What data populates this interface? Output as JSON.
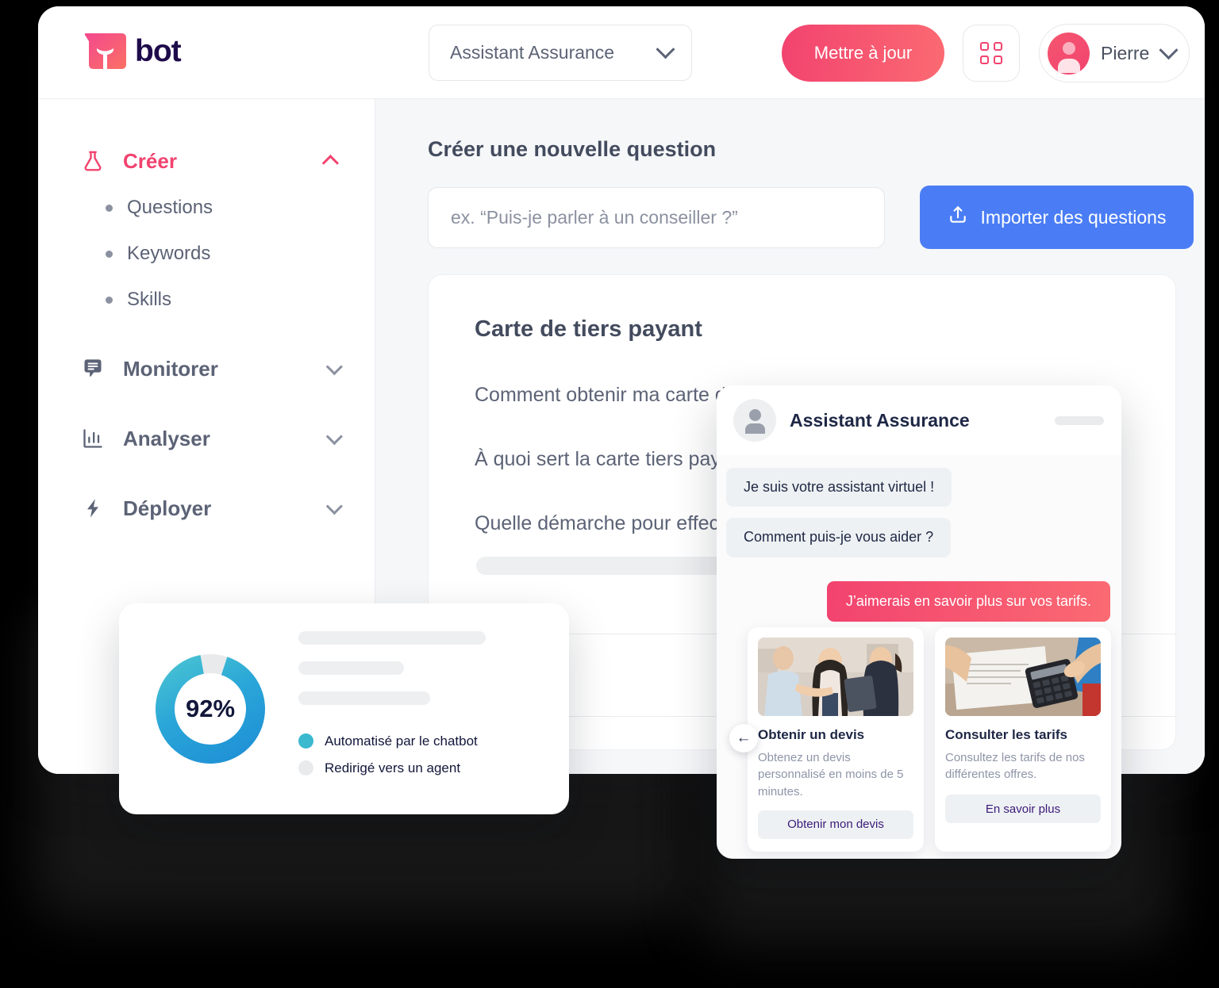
{
  "header": {
    "logo_text": "bot",
    "bot_selector_value": "Assistant Assurance",
    "update_button": "Mettre à jour",
    "apps_icon": "grid-apps-icon",
    "user_name": "Pierre",
    "accent_color": "#f2436f"
  },
  "sidebar": {
    "groups": [
      {
        "label": "Créer",
        "icon": "flask-icon",
        "expanded": true,
        "active": true,
        "items": [
          {
            "label": "Questions"
          },
          {
            "label": "Keywords"
          },
          {
            "label": "Skills"
          }
        ]
      },
      {
        "label": "Monitorer",
        "icon": "chat-lines-icon",
        "expanded": false,
        "active": false,
        "items": []
      },
      {
        "label": "Analyser",
        "icon": "bar-chart-icon",
        "expanded": false,
        "active": false,
        "items": []
      },
      {
        "label": "Déployer",
        "icon": "bolt-icon",
        "expanded": false,
        "active": false,
        "items": []
      }
    ]
  },
  "main": {
    "title": "Créer une nouvelle question",
    "question_input_value": "",
    "question_input_placeholder": "ex. “Puis-je parler à un conseiller ?”",
    "import_button": "Importer des questions",
    "import_icon": "upload-icon",
    "panel": {
      "title": "Carte de tiers payant",
      "questions": [
        "Comment obtenir ma carte de tiers payant ?",
        "À quoi sert la carte tiers payant ?",
        "Quelle démarche pour effectuer un renouvellement ?"
      ]
    }
  },
  "stat_card": {
    "center_label": "92%",
    "legend": [
      {
        "label": "Automatisé par le chatbot",
        "color": "#3ab9cf"
      },
      {
        "label": "Redirigé vers un agent",
        "color": "#e9eaec"
      }
    ]
  },
  "chart_data": {
    "type": "pie",
    "title": "",
    "categories": [
      "Automatisé par le chatbot",
      "Redirigé vers un agent"
    ],
    "values": [
      92,
      8
    ],
    "colors": [
      "#2494d6",
      "#e9eaec"
    ],
    "gradient": [
      "#1e8fd5",
      "#49c3d2"
    ],
    "center_text": "92%",
    "legend_position": "right",
    "donut": true
  },
  "chat_widget": {
    "title": "Assistant Assurance",
    "avatar_icon": "user-avatar-icon",
    "messages": [
      {
        "from": "bot",
        "text": "Je suis votre assistant virtuel !"
      },
      {
        "from": "bot",
        "text": "Comment puis-je vous aider ?"
      },
      {
        "from": "user",
        "text": "J’aimerais en savoir plus sur vos tarifs."
      }
    ],
    "carousel": {
      "prev_icon": "arrow-left-icon",
      "cards": [
        {
          "title": "Obtenir un devis",
          "desc": "Obtenez un devis personnalisé en moins de 5 minutes.",
          "button": "Obtenir mon devis",
          "image": "handshake-advisor-photo"
        },
        {
          "title": "Consulter les tarifs",
          "desc": "Consultez les tarifs de nos différentes offres.",
          "button": "En savoir plus",
          "image": "calculator-documents-photo"
        }
      ]
    }
  }
}
